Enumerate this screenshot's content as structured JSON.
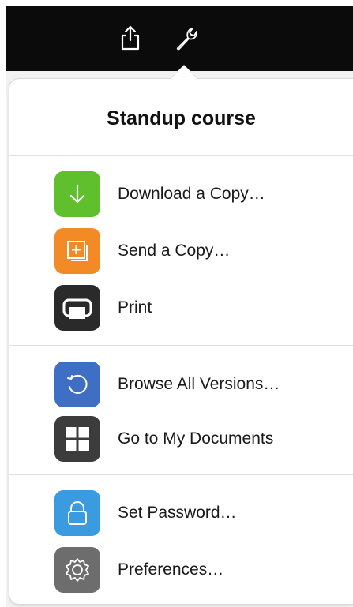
{
  "popover": {
    "title": "Standup course"
  },
  "menu": {
    "items": [
      {
        "label": "Download a Copy…",
        "icon": "download-icon",
        "color": "#5fbf2c"
      },
      {
        "label": "Send a Copy…",
        "icon": "send-copy-icon",
        "color": "#f28a26"
      },
      {
        "label": "Print",
        "icon": "print-icon",
        "color": "#2a2a2a"
      },
      {
        "label": "Browse All Versions…",
        "icon": "versions-icon",
        "color": "#3f6fc4"
      },
      {
        "label": "Go to My Documents",
        "icon": "documents-icon",
        "color": "#3c3c3c"
      },
      {
        "label": "Set Password…",
        "icon": "lock-icon",
        "color": "#3a9be0"
      },
      {
        "label": "Preferences…",
        "icon": "gear-icon",
        "color": "#6d6d6d"
      }
    ]
  },
  "toolbar": {
    "icons": [
      "share-icon",
      "wrench-icon"
    ]
  }
}
